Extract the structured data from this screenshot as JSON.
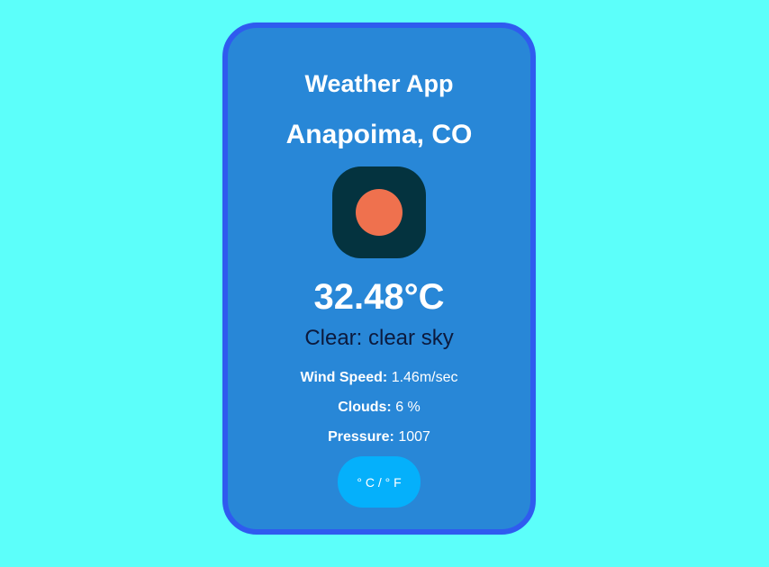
{
  "app": {
    "title": "Weather App"
  },
  "weather": {
    "location": "Anapoima, CO",
    "icon": "clear-sky-sun-icon",
    "temperature": "32.48°C",
    "description": "Clear: clear sky"
  },
  "stats": {
    "wind_label": "Wind Speed:",
    "wind_value": "1.46m/sec",
    "clouds_label": "Clouds:",
    "clouds_value": "6 %",
    "pressure_label": "Pressure:",
    "pressure_value": "1007"
  },
  "toggle": {
    "label": "° C / ° F"
  },
  "colors": {
    "page_background": "#5cfffa",
    "card_background": "#2887d7",
    "card_border": "#2f5bef",
    "icon_background": "#04333f",
    "sun": "#ef714e",
    "button": "#05b0fb",
    "description_text": "#0c1a3d"
  }
}
